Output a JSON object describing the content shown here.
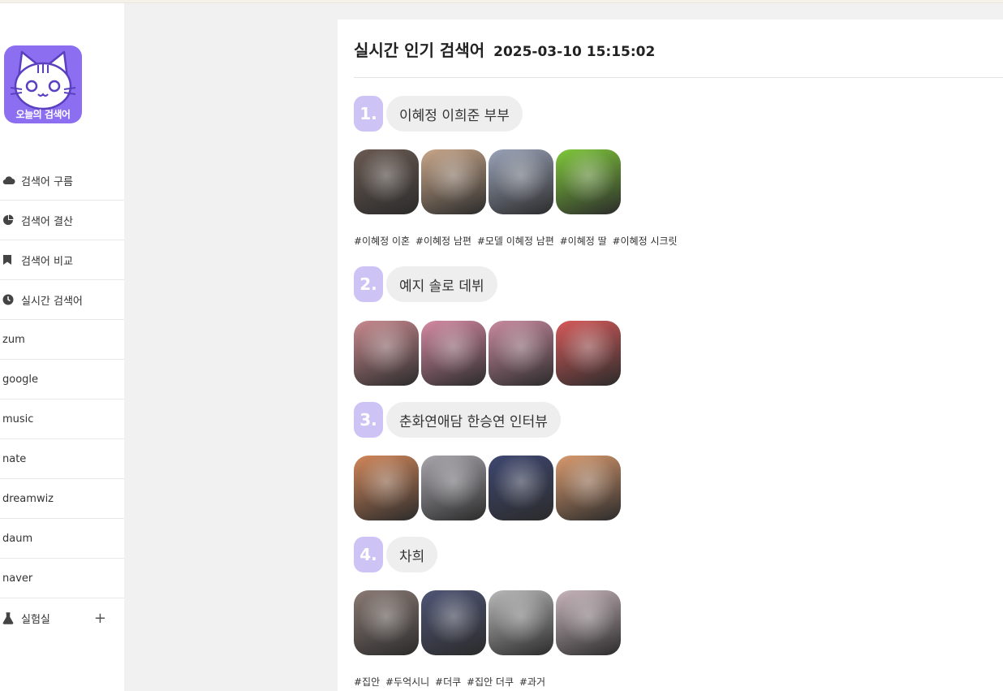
{
  "logo": {
    "text": "오늘의 검색어"
  },
  "menu": [
    {
      "label": "검색어 구름",
      "icon": "cloud-icon"
    },
    {
      "label": "검색어 결산",
      "icon": "pie-chart-icon"
    },
    {
      "label": "검색어 비교",
      "icon": "bookmark-icon"
    },
    {
      "label": "실시간 검색어",
      "icon": "clock-icon"
    },
    {
      "label": "zum"
    },
    {
      "label": "google"
    },
    {
      "label": "music"
    },
    {
      "label": "nate"
    },
    {
      "label": "dreamwiz"
    },
    {
      "label": "daum"
    },
    {
      "label": "naver"
    },
    {
      "label": "실험실",
      "icon": "flask-icon",
      "action": "+"
    }
  ],
  "page": {
    "title": "실시간 인기 검색어",
    "timestamp": "2025-03-10 15:15:02"
  },
  "ranks": [
    {
      "num": "1.",
      "keyword": "이혜정 이희준 부부",
      "thumb_colors": [
        "#6a5a52",
        "#c9a78a",
        "#9aa3b8",
        "#7fc83a"
      ],
      "tags": [
        "#이혜정 이혼",
        "#이혜정 남편",
        "#모델 이혜정 남편",
        "#이혜정 딸",
        "#이혜정 시크릿"
      ]
    },
    {
      "num": "2.",
      "keyword": "예지 솔로 데뷔",
      "thumb_colors": [
        "#c98a8f",
        "#d58aa3",
        "#c98ba0",
        "#d65a5a"
      ],
      "tags": []
    },
    {
      "num": "3.",
      "keyword": "춘화연애담 한승연 인터뷰",
      "thumb_colors": [
        "#d2875a",
        "#a9a6ad",
        "#3e4770",
        "#d99a6e"
      ],
      "tags": []
    },
    {
      "num": "4.",
      "keyword": "차희",
      "thumb_colors": [
        "#8a7a74",
        "#4f5575",
        "#b9b9b9",
        "#c8b6bd"
      ],
      "tags": [
        "#집안",
        "#두억시니",
        "#더쿠",
        "#집안 더쿠",
        "#과거"
      ]
    }
  ],
  "colors": {
    "accent": "#8b6ff0",
    "rank_badge": "#cdc3f4",
    "pill": "#eeeeee",
    "background": "#f1f1f1"
  }
}
